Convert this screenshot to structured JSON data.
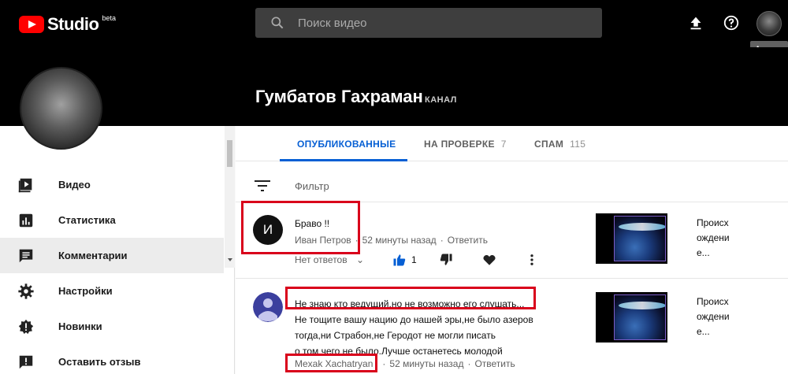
{
  "app": {
    "logo_text": "Studio",
    "beta": "beta",
    "search_placeholder": "Поиск видео",
    "tooltip": "Аккаунт"
  },
  "channel": {
    "name": "Гумбатов Гахраман",
    "tag": "КАНАЛ"
  },
  "sidebar": {
    "items": [
      {
        "label": "Видео",
        "icon": "video-icon"
      },
      {
        "label": "Статистика",
        "icon": "analytics-icon"
      },
      {
        "label": "Комментарии",
        "icon": "comments-icon",
        "active": true
      },
      {
        "label": "Настройки",
        "icon": "settings-icon"
      },
      {
        "label": "Новинки",
        "icon": "whats-new-icon"
      },
      {
        "label": "Оставить отзыв",
        "icon": "feedback-icon"
      }
    ]
  },
  "tabs": [
    {
      "label": "ОПУБЛИКОВАННЫЕ",
      "count": "",
      "active": true
    },
    {
      "label": "НА ПРОВЕРКЕ",
      "count": "7",
      "active": false
    },
    {
      "label": "СПАМ",
      "count": "115",
      "active": false
    }
  ],
  "filter": {
    "label": "Фильтр"
  },
  "comments": [
    {
      "avatar_letter": "И",
      "text": "Браво !!",
      "author": "Иван Петров",
      "time": "52 минуты назад",
      "reply": "Ответить",
      "replies_toggle": "Нет ответов",
      "likes": "1",
      "video_title_lines": [
        "Происх",
        "ождени",
        "е..."
      ]
    },
    {
      "text_lines": [
        "Не знаю кто ведущий,но не возможно его слушать...",
        "Не тощите вашу нацию до нашей эры,не было азеров",
        "тогда,ни Страбон,не Геродот не могли писать",
        "о том чего не было.Лучше останетесь молодой"
      ],
      "author": "Mexak Xachatryan",
      "time": "52 минуты назад",
      "reply": "Ответить",
      "video_title_lines": [
        "Происх",
        "ождени",
        "е..."
      ]
    }
  ],
  "colors": {
    "accent": "#065fd4",
    "highlight_box": "#d9001b",
    "header_bg": "#000000"
  }
}
